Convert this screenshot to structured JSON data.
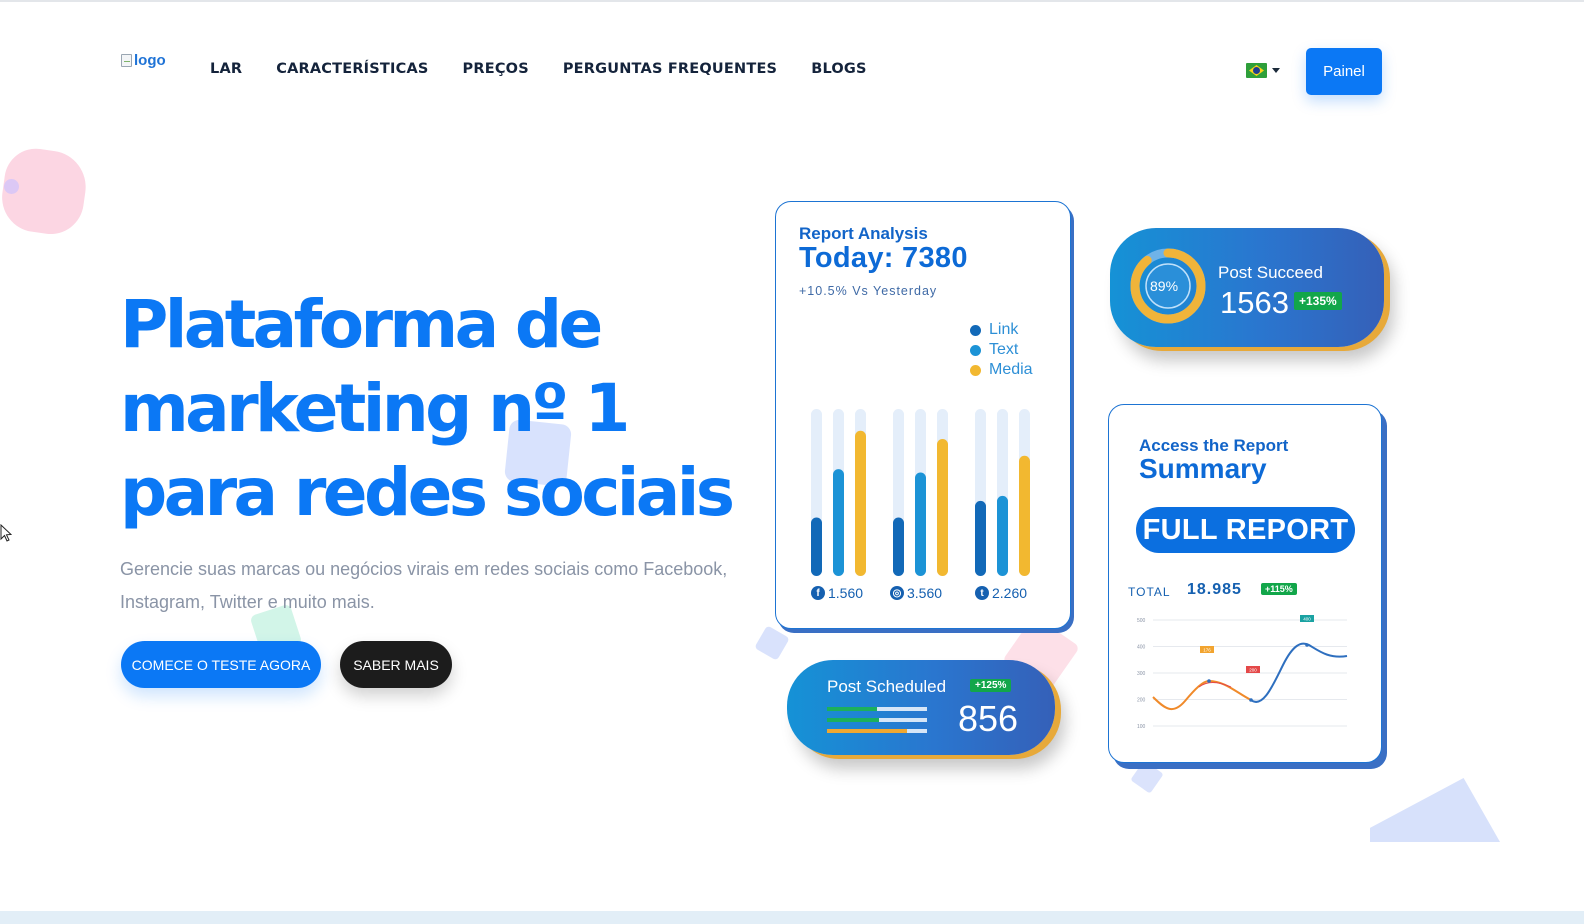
{
  "header": {
    "logo_alt": "logo",
    "nav": [
      "LAR",
      "CARACTERÍSTICAS",
      "PREÇOS",
      "PERGUNTAS FREQUENTES",
      "BLOGS"
    ],
    "language_icon": "brazil-flag-icon",
    "painel_label": "Painel"
  },
  "hero": {
    "title_lines": [
      "Plataforma de",
      "marketing nº 1",
      "para redes sociais"
    ],
    "subtitle": "Gerencie suas marcas ou negócios virais em redes sociais como Facebook, Instagram, Twitter e muito mais.",
    "cta_primary": "COMECE O TESTE AGORA",
    "cta_secondary": "SABER MAIS"
  },
  "report_card": {
    "heading": "Report Analysis",
    "today": "Today: 7380",
    "change": "+10.5% Vs Yesterday",
    "legend": [
      {
        "label": "Link",
        "color": "#1269b8"
      },
      {
        "label": "Text",
        "color": "#1c93d6"
      },
      {
        "label": "Media",
        "color": "#f2b830"
      }
    ],
    "stats": [
      {
        "icon": "facebook-icon",
        "glyph": "f",
        "value": "1.560"
      },
      {
        "icon": "instagram-icon",
        "glyph": "◎",
        "value": "3.560"
      },
      {
        "icon": "twitter-icon",
        "glyph": "t",
        "value": "2.260"
      }
    ],
    "bar_groups": [
      [
        0.35,
        0.64,
        0.87
      ],
      [
        0.35,
        0.62,
        0.82
      ],
      [
        0.45,
        0.48,
        0.72
      ]
    ]
  },
  "succeed_card": {
    "title": "Post Succeed",
    "value": "1563",
    "badge": "+135%",
    "percent_label": "89%",
    "percent": 0.89
  },
  "scheduled_card": {
    "title": "Post Scheduled",
    "value": "856",
    "badge": "+125%",
    "progress": [
      {
        "fraction": 0.5,
        "color": "#1cb05c"
      },
      {
        "fraction": 0.52,
        "color": "#1cb05c"
      },
      {
        "fraction": 0.8,
        "color": "#f0a830"
      }
    ]
  },
  "summary_card": {
    "heading": "Access the Report",
    "title": "Summary",
    "button": "FULL REPORT",
    "total_label": "TOTAL",
    "total_value": "18.985",
    "badge": "+115%",
    "chart_y_ticks": [
      "500",
      "400",
      "300",
      "200",
      "100"
    ],
    "chart_tags": [
      {
        "label": "176",
        "color": "#f2a42f"
      },
      {
        "label": "200",
        "color": "#e44848"
      },
      {
        "label": "400",
        "color": "#1aa2a2"
      }
    ]
  }
}
